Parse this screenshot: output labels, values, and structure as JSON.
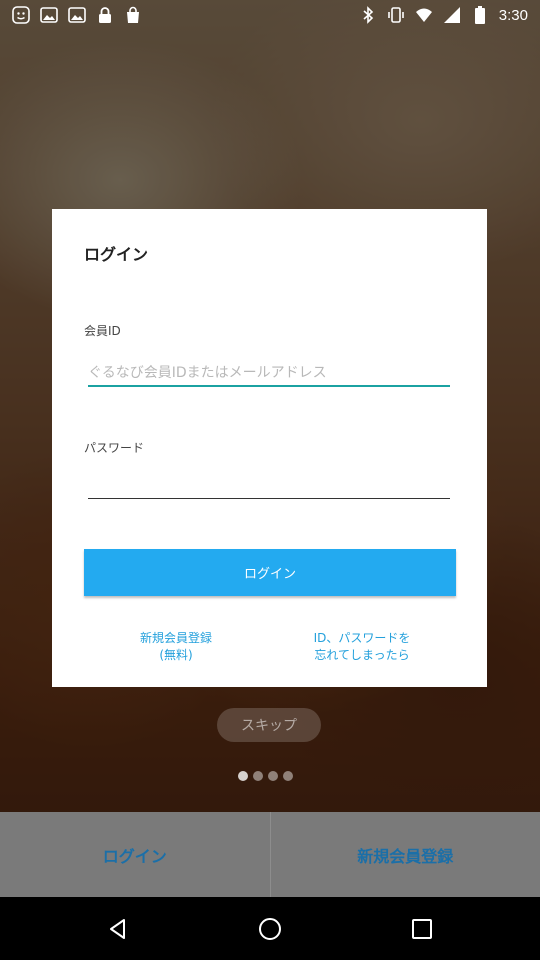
{
  "status_bar": {
    "time": "3:30",
    "left_icons": [
      "face-icon",
      "image-icon",
      "image-icon",
      "lock-icon",
      "bag-icon"
    ],
    "right_icons": [
      "bluetooth-icon",
      "vibrate-icon",
      "wifi-icon",
      "signal-icon",
      "battery-icon"
    ]
  },
  "dialog": {
    "title": "ログイン",
    "member_id_label": "会員ID",
    "member_id_placeholder": "ぐるなび会員IDまたはメールアドレス",
    "password_label": "パスワード",
    "password_value": "",
    "login_button": "ログイン",
    "register_link_line1": "新規会員登録",
    "register_link_line2": "(無料)",
    "forgot_link_line1": "ID、パスワードを",
    "forgot_link_line2": "忘れてしまったら"
  },
  "skip_button": "スキップ",
  "pager": {
    "count": 4,
    "active_index": 0
  },
  "bottom_tabs": {
    "login": "ログイン",
    "register": "新規会員登録"
  },
  "colors": {
    "accent": "#23aaf0",
    "link": "#23a0dc",
    "input_focus": "#1ba2a2",
    "tab_text": "#1b6fa8"
  }
}
